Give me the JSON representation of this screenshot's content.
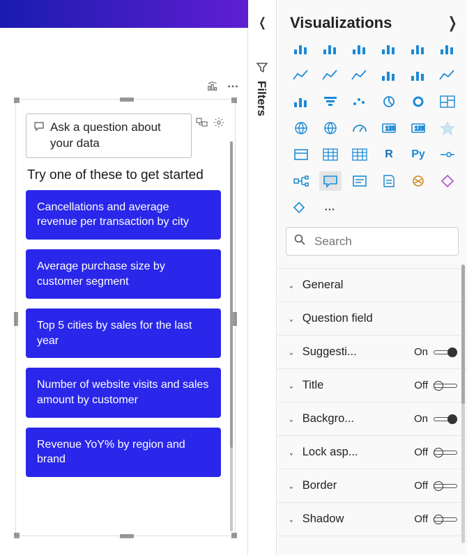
{
  "canvas": {
    "header_icons": {
      "barline": "bar-line-chart-icon",
      "more": "more-icon"
    },
    "qna": {
      "placeholder": "Ask a question about your data",
      "tool_convert": "convert-to-visual-icon",
      "tool_settings": "gear-icon",
      "starter_title": "Try one of these to get started",
      "suggestions": [
        "Cancellations and average revenue per transaction by city",
        "Average purchase size by customer segment",
        "Top 5 cities by sales for the last year",
        "Number of website visits and sales amount by customer",
        "Revenue YoY% by region and brand"
      ]
    }
  },
  "filters": {
    "label": "Filters"
  },
  "viz_panel": {
    "title": "Visualizations",
    "search_placeholder": "Search",
    "icons": [
      "stacked-bar-chart",
      "stacked-column-chart",
      "clustered-bar-chart",
      "clustered-column-chart",
      "100pct-stacked-bar-chart",
      "100pct-stacked-column-chart",
      "line-chart",
      "area-chart",
      "stacked-area-chart",
      "line-stacked-column-chart",
      "line-clustered-column-chart",
      "ribbon-chart",
      "waterfall-chart",
      "funnel-chart",
      "scatter-chart",
      "pie-chart",
      "donut-chart",
      "treemap-chart",
      "map-chart",
      "filled-map-chart",
      "gauge-chart",
      "card-visual",
      "multi-row-card-visual",
      "kpi-visual",
      "slicer-visual",
      "table-visual",
      "matrix-visual",
      "r-script-visual",
      "python-visual",
      "key-influencers-visual",
      "decomposition-tree-visual",
      "qna-visual",
      "smart-narrative-visual",
      "paginated-report-visual",
      "arcgis-visual",
      "power-apps-visual"
    ],
    "icon_letters": {
      "r-script-visual": "R",
      "python-visual": "Py"
    },
    "extra_icons": [
      "power-automate-visual",
      "more-visuals"
    ],
    "selected_icon": "qna-visual",
    "format": [
      {
        "label": "General",
        "toggle": null
      },
      {
        "label": "Question field",
        "toggle": null
      },
      {
        "label": "Suggesti...",
        "toggle": "On"
      },
      {
        "label": "Title",
        "toggle": "Off"
      },
      {
        "label": "Backgro...",
        "toggle": "On"
      },
      {
        "label": "Lock asp...",
        "toggle": "Off"
      },
      {
        "label": "Border",
        "toggle": "Off"
      },
      {
        "label": "Shadow",
        "toggle": "Off"
      }
    ]
  }
}
